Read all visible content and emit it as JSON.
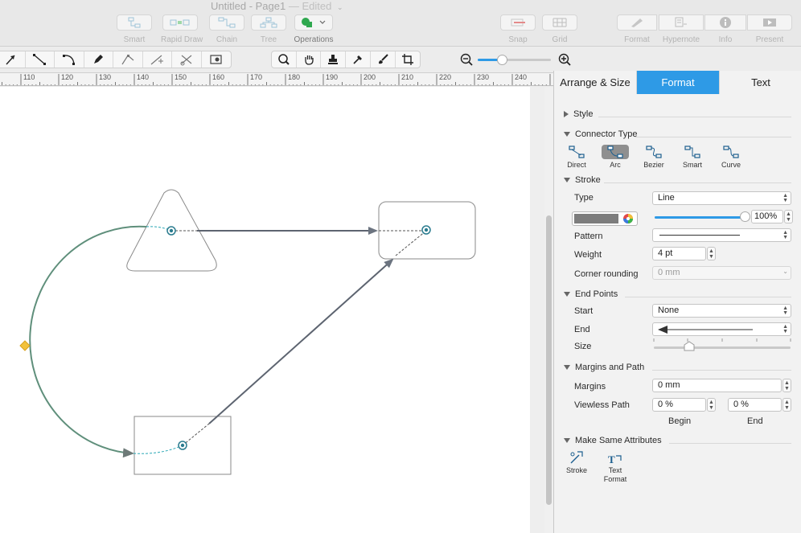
{
  "window": {
    "title": "Untitled - Page1",
    "edited": "— Edited"
  },
  "toolbar": {
    "left_buttons": [
      {
        "label": "Smart",
        "icon": "smart-layout-icon"
      },
      {
        "label": "Rapid Draw",
        "icon": "rapid-draw-icon"
      },
      {
        "label": "Chain",
        "icon": "chain-icon"
      },
      {
        "label": "Tree",
        "icon": "tree-icon"
      },
      {
        "label": "Operations",
        "icon": "operations-icon"
      }
    ],
    "mid_buttons": [
      {
        "label": "Snap",
        "icon": "snap-icon"
      },
      {
        "label": "Grid",
        "icon": "grid-icon"
      }
    ],
    "right_buttons": [
      {
        "label": "Format",
        "icon": "format-icon"
      },
      {
        "label": "Hypernote",
        "icon": "hypernote-icon"
      },
      {
        "label": "Info",
        "icon": "info-icon"
      },
      {
        "label": "Present",
        "icon": "present-icon"
      }
    ]
  },
  "ruler": {
    "labels": [
      "110",
      "120",
      "130",
      "140",
      "150",
      "160",
      "170",
      "180",
      "190",
      "200",
      "210",
      "220",
      "230",
      "240"
    ]
  },
  "inspector": {
    "tabs": [
      "Arrange & Size",
      "Format",
      "Text"
    ],
    "active_tab": "Format",
    "style_section": "Style",
    "connector_type": {
      "title": "Connector Type",
      "options": [
        "Direct",
        "Arc",
        "Bezier",
        "Smart",
        "Curve"
      ],
      "selected": "Arc"
    },
    "stroke": {
      "title": "Stroke",
      "type_label": "Type",
      "type_value": "Line",
      "opacity": "100%",
      "opacity_fraction": 1.0,
      "color": "#7d7d7d",
      "pattern_label": "Pattern",
      "weight_label": "Weight",
      "weight_value": "4 pt",
      "corner_label": "Corner rounding",
      "corner_value": "0 mm"
    },
    "end_points": {
      "title": "End Points",
      "start_label": "Start",
      "start_value": "None",
      "end_label": "End",
      "size_label": "Size"
    },
    "margins_path": {
      "title": "Margins and Path",
      "margins_label": "Margins",
      "margins_value": "0 mm",
      "viewless_label": "Viewless Path",
      "begin_value": "0 %",
      "end_value": "0 %",
      "begin_label": "Begin",
      "end_label": "End"
    },
    "same_attributes": {
      "title": "Make Same Attributes",
      "stroke_label": "Stroke",
      "text_format_label": "Text Format"
    }
  },
  "colors": {
    "accent": "#2e9ae6",
    "connector_selected": "#5f8f7b",
    "connector": "#66707d",
    "handle": "#f2c23c"
  }
}
